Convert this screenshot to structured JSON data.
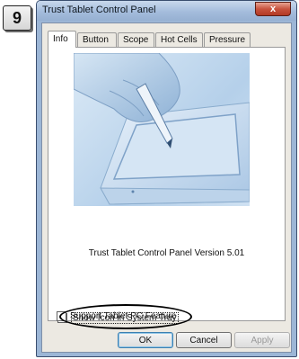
{
  "step": {
    "number": "9"
  },
  "window": {
    "title": "Trust Tablet Control Panel",
    "close_glyph": "x"
  },
  "tabs": [
    {
      "label": "Info",
      "active": true
    },
    {
      "label": "Button"
    },
    {
      "label": "Scope"
    },
    {
      "label": "Hot Cells"
    },
    {
      "label": "Pressure"
    }
  ],
  "info": {
    "version_text": "Trust Tablet Control Panel Version 5.01",
    "show_icon": {
      "label": "Show Icon in System Tray",
      "checked": true,
      "mark": "✓"
    },
    "support_tablet": {
      "label": "Support Tablet PC Feature",
      "checked": false
    }
  },
  "buttons": {
    "ok": "OK",
    "cancel": "Cancel",
    "apply": "Apply"
  },
  "colors": {
    "title_bar": "#a4bcdc",
    "close_button": "#c8523e",
    "dialog_face": "#ece9e2"
  }
}
